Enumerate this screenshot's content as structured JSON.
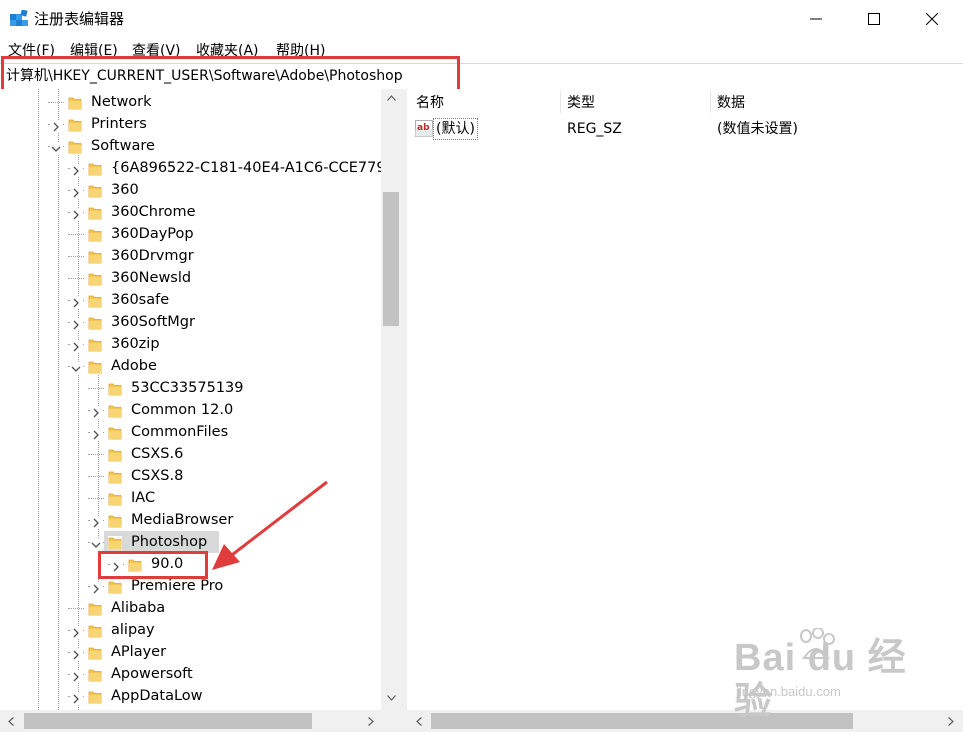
{
  "window": {
    "title": "注册表编辑器",
    "controls": [
      "minimize",
      "maximize",
      "close"
    ]
  },
  "menu": [
    "文件(F)",
    "编辑(E)",
    "查看(V)",
    "收藏夹(A)",
    "帮助(H)"
  ],
  "address": {
    "path": "计算机\\HKEY_CURRENT_USER\\Software\\Adobe\\Photoshop"
  },
  "tree": {
    "nodes": [
      {
        "label": "Network",
        "level": 1,
        "expander": "none"
      },
      {
        "label": "Printers",
        "level": 1,
        "expander": "collapsed"
      },
      {
        "label": "Software",
        "level": 1,
        "expander": "expanded"
      },
      {
        "label": "{6A896522-C181-40E4-A1C6-CCE779",
        "level": 2,
        "expander": "collapsed"
      },
      {
        "label": "360",
        "level": 2,
        "expander": "collapsed"
      },
      {
        "label": "360Chrome",
        "level": 2,
        "expander": "collapsed"
      },
      {
        "label": "360DayPop",
        "level": 2,
        "expander": "none"
      },
      {
        "label": "360Drvmgr",
        "level": 2,
        "expander": "none"
      },
      {
        "label": "360Newsld",
        "level": 2,
        "expander": "none"
      },
      {
        "label": "360safe",
        "level": 2,
        "expander": "collapsed"
      },
      {
        "label": "360SoftMgr",
        "level": 2,
        "expander": "collapsed"
      },
      {
        "label": "360zip",
        "level": 2,
        "expander": "collapsed"
      },
      {
        "label": "Adobe",
        "level": 2,
        "expander": "expanded"
      },
      {
        "label": "53CC33575139",
        "level": 3,
        "expander": "none"
      },
      {
        "label": "Common 12.0",
        "level": 3,
        "expander": "collapsed"
      },
      {
        "label": "CommonFiles",
        "level": 3,
        "expander": "collapsed"
      },
      {
        "label": "CSXS.6",
        "level": 3,
        "expander": "none"
      },
      {
        "label": "CSXS.8",
        "level": 3,
        "expander": "none"
      },
      {
        "label": "IAC",
        "level": 3,
        "expander": "none"
      },
      {
        "label": "MediaBrowser",
        "level": 3,
        "expander": "collapsed"
      },
      {
        "label": "Photoshop",
        "level": 3,
        "expander": "expanded",
        "selected": true
      },
      {
        "label": "90.0",
        "level": 4,
        "expander": "collapsed",
        "highlighted": true
      },
      {
        "label": "Premiere Pro",
        "level": 3,
        "expander": "collapsed"
      },
      {
        "label": "Alibaba",
        "level": 2,
        "expander": "none"
      },
      {
        "label": "alipay",
        "level": 2,
        "expander": "collapsed"
      },
      {
        "label": "APlayer",
        "level": 2,
        "expander": "collapsed"
      },
      {
        "label": "Apowersoft",
        "level": 2,
        "expander": "collapsed"
      },
      {
        "label": "AppDataLow",
        "level": 2,
        "expander": "collapsed"
      }
    ]
  },
  "values": {
    "columns": [
      "名称",
      "类型",
      "数据"
    ],
    "rows": [
      {
        "icon": "string-value-icon",
        "icon_text": "ab",
        "name": "(默认)",
        "type": "REG_SZ",
        "data": "(数值未设置)"
      }
    ]
  },
  "watermark": {
    "main": "Bai du 经验",
    "sub": "jingyan.baidu.com"
  },
  "colors": {
    "annotation_red": "#e03c3c",
    "folder_yellow": "#f5c451",
    "selection_gray": "#d9d9d9"
  }
}
